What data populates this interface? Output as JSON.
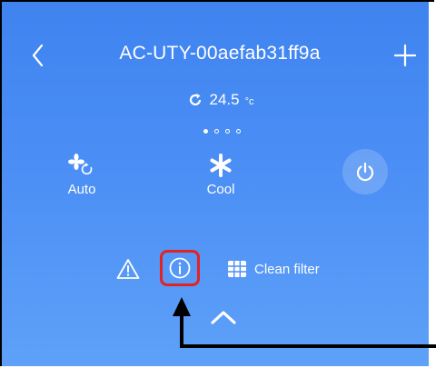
{
  "header": {
    "title": "AC-UTY-00aefab31ff9a"
  },
  "temperature": {
    "value": "24.5",
    "unit": "°c"
  },
  "pager": {
    "count": 4,
    "active": 0
  },
  "modes": {
    "fan_label": "Auto",
    "mode_label": "Cool"
  },
  "status": {
    "filter_label": "Clean filter"
  },
  "colors": {
    "background_top": "#3f83f0",
    "background_bottom": "#5ea1f8",
    "highlight": "#e32222",
    "annotation": "#000000"
  },
  "icons": [
    "back-chevron-icon",
    "plus-icon",
    "refresh-icon",
    "fan-icon",
    "snowflake-icon",
    "power-icon",
    "warning-icon",
    "info-icon",
    "filter-grid-icon",
    "chevron-up-icon"
  ]
}
